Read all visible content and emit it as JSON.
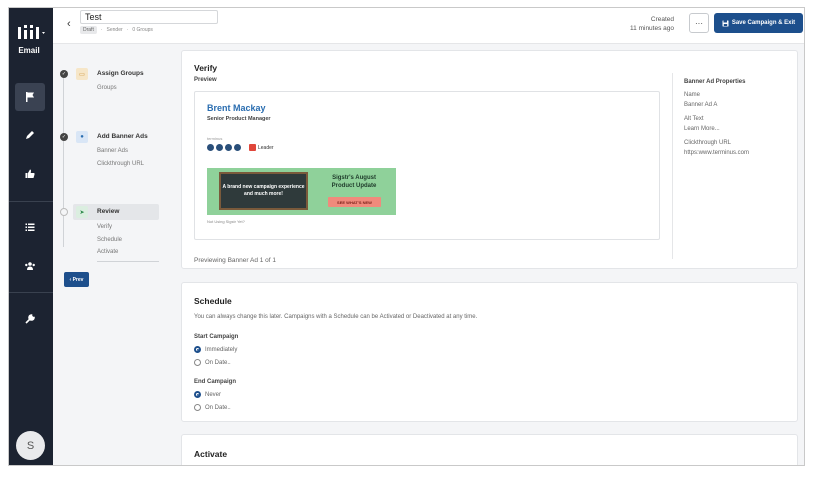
{
  "app": {
    "section": "Email",
    "user_initial": "S"
  },
  "header": {
    "back": "‹",
    "title": "Test",
    "breadcrumb": {
      "status": "Draft",
      "sender": "Sender",
      "groups": "0 Groups"
    },
    "created_label": "Created",
    "created_value": "11 minutes ago",
    "more": "···",
    "save_label": "Save Campaign & Exit"
  },
  "steps": [
    {
      "title": "Assign Groups",
      "subs": [
        "Groups"
      ]
    },
    {
      "title": "Add Banner Ads",
      "subs": [
        "Banner Ads",
        "Clickthrough URL"
      ]
    },
    {
      "title": "Review",
      "subs": [
        "Verify",
        "Schedule",
        "Activate"
      ]
    }
  ],
  "prev_label": "‹ Prev",
  "verify": {
    "title": "Verify",
    "preview_label": "Preview",
    "signature": {
      "name": "Brent Mackay",
      "role": "Senior Product Manager",
      "logo_text": "terminus",
      "badge_text": "Leader"
    },
    "banner": {
      "left_text": "A brand new campaign experience and much more!",
      "right_title": "Sigstr's August Product Update",
      "button": "SEE WHAT'S NEW"
    },
    "not_using": "Not Using Sigstr Yet?",
    "previewing": "Previewing Banner Ad 1 of 1",
    "props": {
      "title": "Banner Ad Properties",
      "name_label": "Name",
      "name_value": "Banner Ad A",
      "alt_label": "Alt Text",
      "alt_value": "Learn More...",
      "url_label": "Clickthrough URL",
      "url_value": "https:www.terminus.com"
    }
  },
  "schedule": {
    "title": "Schedule",
    "description": "You can always change this later. Campaigns with a Schedule can be Activated or Deactivated at any time.",
    "start_label": "Start Campaign",
    "start_options": [
      "Immediately",
      "On Date.."
    ],
    "end_label": "End Campaign",
    "end_options": [
      "Never",
      "On Date.."
    ]
  },
  "activate": {
    "title": "Activate"
  },
  "colors": {
    "primary": "#1d4f8c",
    "rail": "#1c2331",
    "banner_green": "#8fd19a"
  }
}
